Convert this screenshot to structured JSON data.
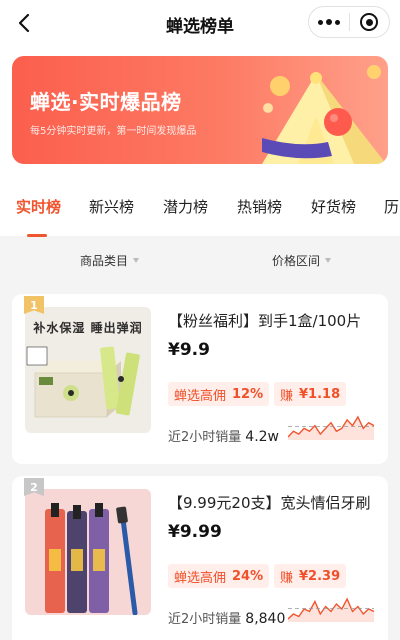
{
  "header": {
    "title": "蝉选榜单"
  },
  "banner": {
    "title": "蝉选·实时爆品榜",
    "subtitle": "每5分钟实时更新，第一时间发现爆品",
    "colors": {
      "from": "#fb5f4d",
      "to": "#ffa08a"
    }
  },
  "tabs": [
    {
      "label": "实时榜",
      "active": true
    },
    {
      "label": "新兴榜",
      "active": false
    },
    {
      "label": "潜力榜",
      "active": false
    },
    {
      "label": "热销榜",
      "active": false
    },
    {
      "label": "好货榜",
      "active": false
    },
    {
      "label": "历",
      "active": false
    }
  ],
  "filters": {
    "category": "商品类目",
    "price": "价格区间"
  },
  "accent_color": "#f0552f",
  "products": [
    {
      "rank": "1",
      "title": "【粉丝福利】到手1盒/100片",
      "price": "¥9.9",
      "commission_label": "蝉选高佣",
      "commission_rate": "12%",
      "earn_label": "赚",
      "earn_amount": "¥1.18",
      "sales_label": "近2小时销量",
      "sales_value": "4.2w",
      "image_caption": "补水保湿 睡出弹润",
      "trend": [
        3,
        5,
        4,
        6,
        5,
        7,
        4,
        6,
        8,
        5,
        6,
        9,
        7,
        10,
        6,
        8,
        7
      ]
    },
    {
      "rank": "2",
      "title": "【9.99元20支】宽头情侣牙刷",
      "price": "¥9.99",
      "commission_label": "蝉选高佣",
      "commission_rate": "24%",
      "earn_label": "赚",
      "earn_amount": "¥2.39",
      "sales_label": "近2小时销量",
      "sales_value": "8,840",
      "trend": [
        2,
        4,
        3,
        6,
        5,
        9,
        4,
        7,
        5,
        8,
        6,
        10,
        5,
        7,
        4,
        6,
        5
      ]
    }
  ]
}
